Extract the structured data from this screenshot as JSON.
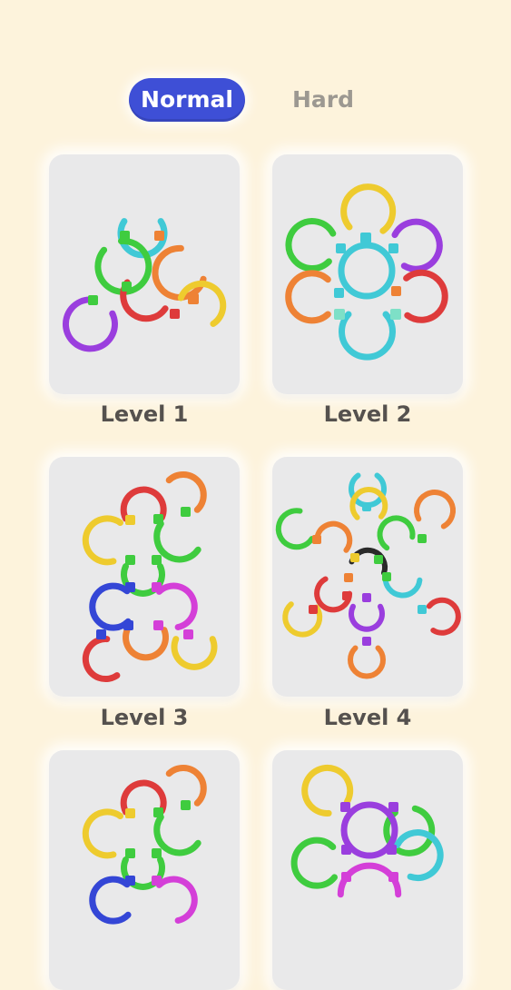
{
  "tabs": {
    "normal_label": "Normal",
    "hard_label": "Hard",
    "active": "normal"
  },
  "levels": [
    {
      "label": "Level 1"
    },
    {
      "label": "Level 2"
    },
    {
      "label": "Level 3"
    },
    {
      "label": "Level 4"
    },
    {
      "label": ""
    },
    {
      "label": ""
    }
  ],
  "colors": {
    "background": "#fdf3dc",
    "active_tab": "#3e4fd6",
    "inactive_tab_text": "#9c9891",
    "card": "#e9e9ea",
    "label_text": "#55514e",
    "cyan": "#40c9d6",
    "green": "#3fcc3f",
    "orange": "#ee8235",
    "red": "#de3b3b",
    "purple": "#9a3ede",
    "yellow": "#eecb2e",
    "blue": "#3446d6",
    "magenta": "#d43fd8",
    "black": "#2a2a2a"
  }
}
